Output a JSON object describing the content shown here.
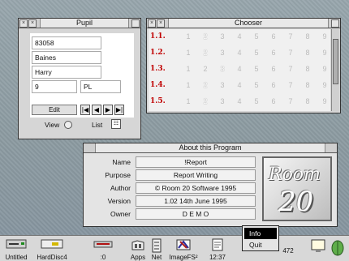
{
  "pupil": {
    "title": "Pupil",
    "fields": [
      "83058",
      "Baines",
      "Harry",
      "9",
      "PL"
    ],
    "edit_label": "Edit",
    "nav": [
      "|◀",
      "◀",
      "▶",
      "▶|"
    ],
    "view_label": "View",
    "list_label": "List"
  },
  "chooser": {
    "title": "Chooser",
    "rows": [
      {
        "label": "1.1.",
        "selected": 2
      },
      {
        "label": "1.2.",
        "selected": 2
      },
      {
        "label": "1.3.",
        "selected": 3
      },
      {
        "label": "1.4.",
        "selected": 2
      },
      {
        "label": "1.5.",
        "selected": 2
      }
    ],
    "numbers": [
      "1",
      "2",
      "3",
      "4",
      "5",
      "6",
      "7",
      "8",
      "9"
    ]
  },
  "about": {
    "title": "About this Program",
    "rows": [
      {
        "key": "Name",
        "value": "!Report"
      },
      {
        "key": "Purpose",
        "value": "Report Writing"
      },
      {
        "key": "Author",
        "value": "© Room 20 Software 1995"
      },
      {
        "key": "Version",
        "value": "1.02 14th June 1995"
      },
      {
        "key": "Owner",
        "value": "D E M O"
      }
    ],
    "logo_line1": "Room",
    "logo_line2": "20"
  },
  "menu": {
    "items": [
      "Info",
      "Quit"
    ]
  },
  "iconbar": {
    "items": [
      "Untitled",
      "HardDisc4",
      ":0",
      "Apps",
      "Net",
      "ImageFS²",
      "12:37",
      "472"
    ]
  }
}
